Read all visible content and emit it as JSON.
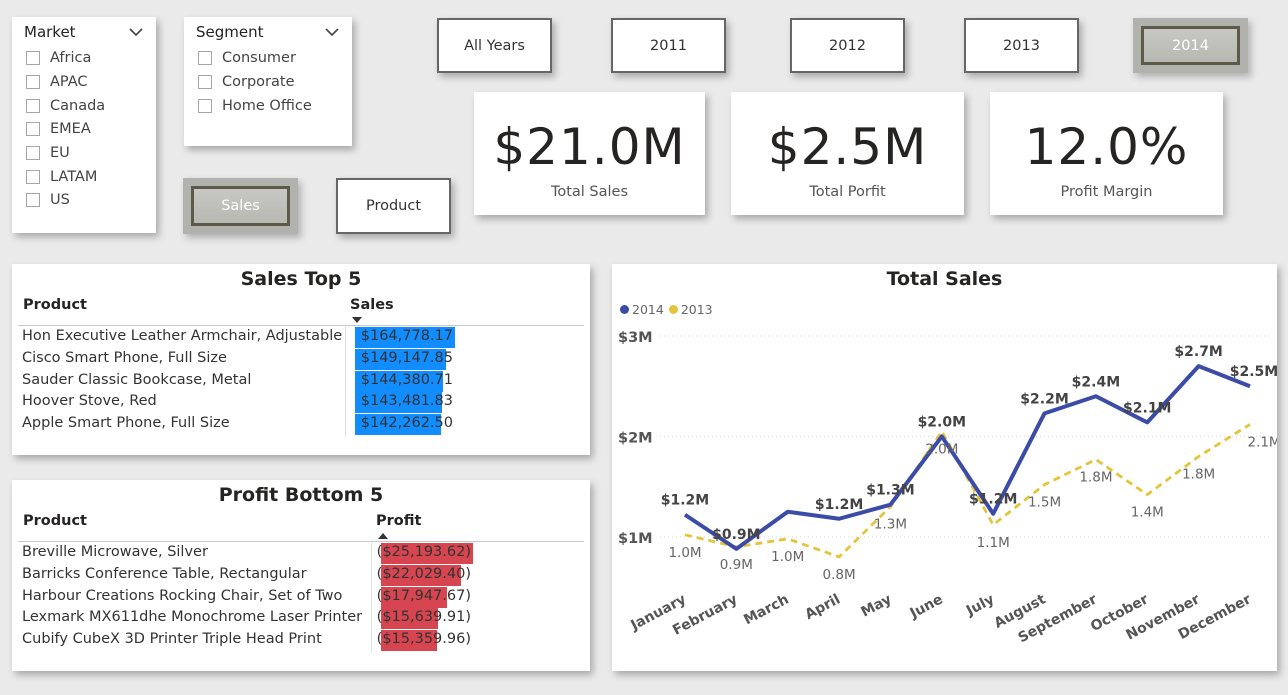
{
  "market_slicer": {
    "title": "Market",
    "options": [
      "Africa",
      "APAC",
      "Canada",
      "EMEA",
      "EU",
      "LATAM",
      "US"
    ]
  },
  "segment_slicer": {
    "title": "Segment",
    "options": [
      "Consumer",
      "Corporate",
      "Home Office"
    ]
  },
  "view_buttons": {
    "sales": "Sales",
    "product": "Product",
    "selected": "Sales"
  },
  "year_buttons": {
    "all": "All Years",
    "y2011": "2011",
    "y2012": "2012",
    "y2013": "2013",
    "y2014": "2014",
    "selected": "2014"
  },
  "kpis": {
    "total_sales": {
      "value": "$21.0M",
      "label": "Total Sales"
    },
    "total_profit": {
      "value": "$2.5M",
      "label": "Total Porfit"
    },
    "profit_margin": {
      "value": "12.0%",
      "label": "Profit Margin"
    }
  },
  "sales_top5": {
    "title": "Sales Top 5",
    "col_product": "Product",
    "col_value": "Sales",
    "rows": [
      {
        "product": "Hon Executive Leather Armchair, Adjustable",
        "value": "$164,778.17",
        "amount": 164778.17
      },
      {
        "product": "Cisco Smart Phone, Full Size",
        "value": "$149,147.85",
        "amount": 149147.85
      },
      {
        "product": "Sauder Classic Bookcase, Metal",
        "value": "$144,380.71",
        "amount": 144380.71
      },
      {
        "product": "Hoover Stove, Red",
        "value": "$143,481.83",
        "amount": 143481.83
      },
      {
        "product": "Apple Smart Phone, Full Size",
        "value": "$142,262.50",
        "amount": 142262.5
      }
    ]
  },
  "profit_bottom5": {
    "title": "Profit Bottom 5",
    "col_product": "Product",
    "col_value": "Profit",
    "rows": [
      {
        "product": "Breville Microwave, Silver",
        "value": "($25,193.62)",
        "amount": -25193.62
      },
      {
        "product": "Barricks Conference Table, Rectangular",
        "value": "($22,029.40)",
        "amount": -22029.4
      },
      {
        "product": "Harbour Creations Rocking Chair, Set of Two",
        "value": "($17,947.67)",
        "amount": -17947.67
      },
      {
        "product": "Lexmark MX611dhe Monochrome Laser Printer",
        "value": "($15,639.91)",
        "amount": -15639.91
      },
      {
        "product": "Cubify CubeX 3D Printer Triple Head Print",
        "value": "($15,359.96)",
        "amount": -15359.96
      }
    ]
  },
  "colors": {
    "sales_bar": "#118dff",
    "profit_bar": "#d64550",
    "series_2014": "#3b4ba8",
    "series_2013": "#e3c43a"
  },
  "chart_data": {
    "type": "line",
    "title": "Total Sales",
    "categories": [
      "January",
      "February",
      "March",
      "April",
      "May",
      "June",
      "July",
      "August",
      "September",
      "October",
      "November",
      "December"
    ],
    "series": [
      {
        "name": "2014",
        "values": [
          1.22,
          0.88,
          1.25,
          1.18,
          1.32,
          2.0,
          1.23,
          2.23,
          2.4,
          2.14,
          2.7,
          2.5
        ],
        "labels": [
          "$1.2M",
          "$0.9M",
          "",
          "$1.2M",
          "$1.3M",
          "$2.0M",
          "$1.2M",
          "$2.2M",
          "$2.4M",
          "$2.1M",
          "$2.7M",
          "$2.5M"
        ]
      },
      {
        "name": "2013",
        "values": [
          1.02,
          0.9,
          0.98,
          0.8,
          1.3,
          2.05,
          1.12,
          1.52,
          1.77,
          1.42,
          1.8,
          2.12
        ],
        "labels": [
          "1.0M",
          "0.9M",
          "1.0M",
          "0.8M",
          "1.3M",
          "2.0M",
          "1.1M",
          "1.5M",
          "1.8M",
          "1.4M",
          "1.8M",
          "2.1M"
        ]
      }
    ],
    "yticks": [
      "$1M",
      "$2M",
      "$3M"
    ],
    "ytick_values": [
      1,
      2,
      3
    ],
    "ylim": [
      0.55,
      3.1
    ],
    "legend": "top-left",
    "grid": true
  }
}
